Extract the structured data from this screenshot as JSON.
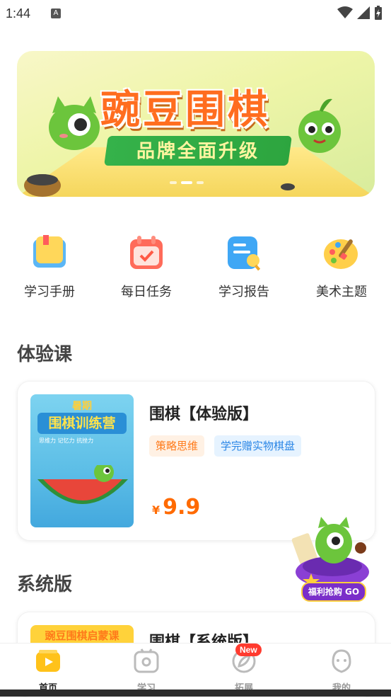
{
  "status": {
    "time": "1:44",
    "a_badge": "A"
  },
  "banner": {
    "title": "豌豆围棋",
    "subtitle": "品牌全面升级"
  },
  "quick_entries": [
    {
      "label": "学习手册",
      "icon": "book-icon"
    },
    {
      "label": "每日任务",
      "icon": "calendar-check-icon"
    },
    {
      "label": "学习报告",
      "icon": "report-icon"
    },
    {
      "label": "美术主题",
      "icon": "palette-icon"
    }
  ],
  "sections": {
    "trial": {
      "title": "体验课",
      "course": {
        "name": "围棋【体验版】",
        "tags": [
          "策略思维",
          "学完赠实物棋盘"
        ],
        "currency": "¥",
        "price": "9.9",
        "cover": {
          "top": "暑期",
          "title": "围棋训练营",
          "tags": "思维力  记忆力  抗挫力"
        }
      }
    },
    "system": {
      "title": "系统版",
      "course": {
        "name": "围棋【系统版】",
        "cover_title": "豌豆围棋启蒙课"
      }
    }
  },
  "float_badge": {
    "label": "福利抢购 GO"
  },
  "tabbar": [
    {
      "label": "首页",
      "icon": "home-icon",
      "active": true
    },
    {
      "label": "学习",
      "icon": "study-icon",
      "active": false
    },
    {
      "label": "拓展",
      "icon": "explore-icon",
      "active": false,
      "badge": "New"
    },
    {
      "label": "我的",
      "icon": "profile-icon",
      "active": false
    }
  ],
  "colors": {
    "accent": "#ff6a00",
    "tag_orange_bg": "#fff1e4",
    "tag_blue_bg": "#e6f3ff",
    "brand_green": "#35b24a"
  }
}
